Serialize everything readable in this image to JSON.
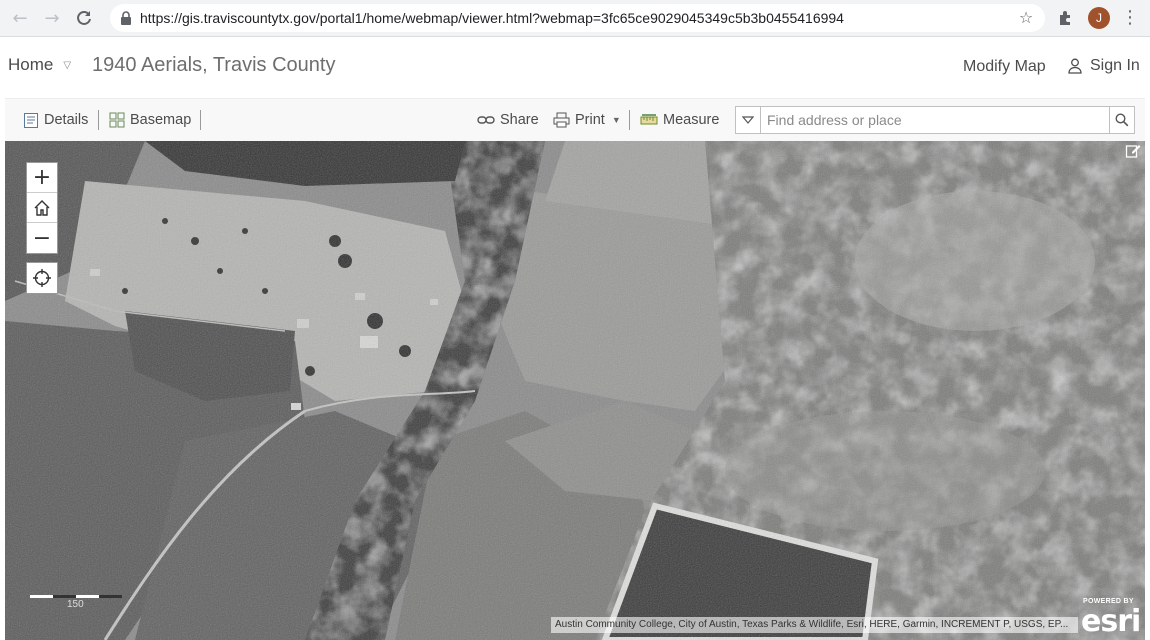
{
  "browser": {
    "url": "https://gis.traviscountytx.gov/portal1/home/webmap/viewer.html?webmap=3fc65ce9029045349c5b3b0455416994",
    "avatar_initial": "J"
  },
  "header": {
    "home_label": "Home",
    "map_title": "1940 Aerials, Travis County",
    "modify_map_label": "Modify Map",
    "sign_in_label": "Sign In"
  },
  "toolbar": {
    "details_label": "Details",
    "basemap_label": "Basemap",
    "share_label": "Share",
    "print_label": "Print",
    "measure_label": "Measure",
    "search_placeholder": "Find address or place"
  },
  "map": {
    "zoom_in_glyph": "+",
    "zoom_out_glyph": "−",
    "scale_label": "150",
    "attribution": "Austin Community College, City of Austin, Texas Parks & Wildlife, Esri, HERE, Garmin, INCREMENT P, USGS, EP...",
    "esri_powered_by": "POWERED BY",
    "esri_wordmark": "esri",
    "image_type": "black-and-white aerial photograph"
  },
  "icons": [
    "back-arrow-icon",
    "forward-arrow-icon",
    "reload-icon",
    "lock-icon",
    "star-icon",
    "extensions-icon",
    "kebab-menu-icon",
    "chevron-down-icon",
    "user-icon",
    "details-icon",
    "basemap-icon",
    "share-link-icon",
    "print-icon",
    "measure-icon",
    "search-icon",
    "home-icon",
    "locate-icon",
    "edit-icon"
  ],
  "colors": {
    "browser_bar": "#f1f3f4",
    "toolbar": "#f8f8f8",
    "text": "#4c4c4c"
  }
}
